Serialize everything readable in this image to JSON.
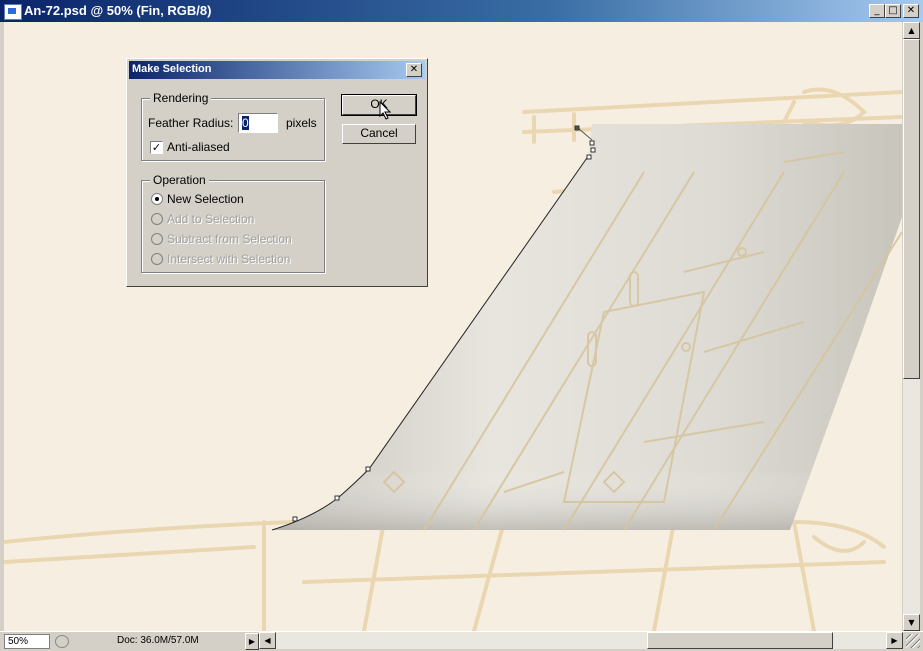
{
  "window": {
    "title": "An-72.psd @ 50% (Fin, RGB/8)",
    "controls": {
      "minimize": "_",
      "maximize": "□",
      "close": "✕"
    }
  },
  "statusbar": {
    "zoom": "50%",
    "doc_info": "Doc: 36.0M/57.0M",
    "arrow": "▶"
  },
  "scrollbars": {
    "up": "▲",
    "down": "▼",
    "left": "◀",
    "right": "▶"
  },
  "dialog": {
    "title": "Make Selection",
    "close": "✕",
    "rendering": {
      "legend": "Rendering",
      "feather_label": "Feather Radius:",
      "feather_value": "0",
      "feather_unit": "pixels",
      "anti_aliased_label": "Anti-aliased",
      "anti_aliased_checked": true
    },
    "operation": {
      "legend": "Operation",
      "options": [
        {
          "label": "New Selection",
          "selected": true,
          "enabled": true
        },
        {
          "label": "Add to Selection",
          "selected": false,
          "enabled": false
        },
        {
          "label": "Subtract from Selection",
          "selected": false,
          "enabled": false
        },
        {
          "label": "Intersect with Selection",
          "selected": false,
          "enabled": false
        }
      ]
    },
    "ok_label": "OK",
    "cancel_label": "Cancel"
  },
  "icons": [
    "photoshop-document-icon",
    "minimize-icon",
    "maximize-icon",
    "close-icon",
    "cursor-arrow-icon",
    "status-info-icon"
  ],
  "colors": {
    "canvas_bg": "#f6efe1",
    "sketch": "#e8d4ac",
    "title_gradient_start": "#0a246a",
    "fin_fill": "#dedbd4"
  }
}
